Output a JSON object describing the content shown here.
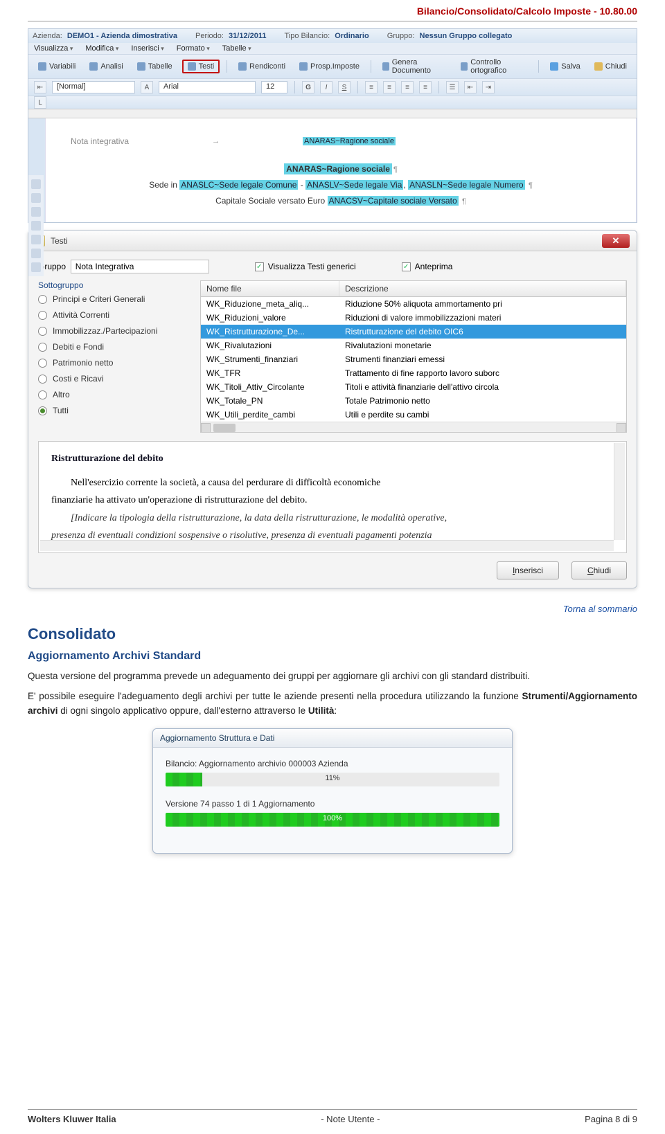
{
  "header": {
    "breadcrumb": "Bilancio/Consolidato/Calcolo Imposte  -  10.80.00"
  },
  "app": {
    "labels": {
      "azienda": "Azienda:",
      "periodo": "Periodo:",
      "tipo": "Tipo Bilancio:",
      "gruppo": "Gruppo:"
    },
    "values": {
      "azienda": "DEMO1 - Azienda dimostrativa",
      "periodo": "31/12/2011",
      "tipo": "Ordinario",
      "gruppo": "Nessun Gruppo collegato"
    },
    "menu": [
      "Visualizza",
      "Modifica",
      "Inserisci",
      "Formato",
      "Tabelle"
    ],
    "toolbar": {
      "variabili": "Variabili",
      "analisi": "Analisi",
      "tabelle": "Tabelle",
      "testi": "Testi",
      "rendiconti": "Rendiconti",
      "prosp": "Prosp.Imposte",
      "genera": "Genera Documento",
      "spell": "Controllo ortografico",
      "salva": "Salva",
      "chiudi": "Chiudi"
    },
    "format": {
      "style": "[Normal]",
      "font": "Arial",
      "size": "12"
    },
    "doc": {
      "nota": "Nota integrativa",
      "ragione": "ANARAS~Ragione sociale",
      "title": "ANARAS~Ragione sociale",
      "sede_pre": "Sede in ",
      "sede_comune": "ANASLC~Sede legale Comune",
      "sede_mid": " - ",
      "sede_via": "ANASLV~Sede legale Via",
      "sede_coma": ", ",
      "sede_num": "ANASLN~Sede legale Numero",
      "cap_pre": "Capitale Sociale versato Euro ",
      "cap_hl": "ANACSV~Capitale sociale Versato"
    }
  },
  "dialog": {
    "title": "Testi",
    "gruppo_label": "Gruppo",
    "gruppo_value": "Nota Integrativa",
    "chk_visualizza": "Visualizza Testi generici",
    "chk_anteprima": "Anteprima",
    "sotto_label": "Sottogruppo",
    "radios": [
      "Principi e Criteri Generali",
      "Attività Correnti",
      "Immobilizzaz./Partecipazioni",
      "Debiti e Fondi",
      "Patrimonio netto",
      "Costi e Ricavi",
      "Altro",
      "Tutti"
    ],
    "radio_selected_index": 7,
    "table": {
      "col1": "Nome file",
      "col2": "Descrizione",
      "rows": [
        {
          "f": "WK_Riduzione_meta_aliq...",
          "d": "Riduzione 50% aliquota ammortamento pri"
        },
        {
          "f": "WK_Riduzioni_valore",
          "d": "Riduzioni di valore immobilizzazioni materi"
        },
        {
          "f": "WK_Ristrutturazione_De...",
          "d": "Ristrutturazione del debito OIC6",
          "sel": true
        },
        {
          "f": "WK_Rivalutazioni",
          "d": "Rivalutazioni monetarie"
        },
        {
          "f": "WK_Strumenti_finanziari",
          "d": "Strumenti finanziari emessi"
        },
        {
          "f": "WK_TFR",
          "d": "Trattamento di fine rapporto lavoro suborc"
        },
        {
          "f": "WK_Titoli_Attiv_Circolante",
          "d": "Titoli e attività finanziarie dell'attivo circola"
        },
        {
          "f": "WK_Totale_PN",
          "d": "Totale Patrimonio netto"
        },
        {
          "f": "WK_Utili_perdite_cambi",
          "d": "Utili e perdite su cambi"
        }
      ]
    },
    "preview": {
      "title": "Ristrutturazione del debito",
      "p1a": "Nell'esercizio corrente la società, a causa del perdurare di difficoltà economiche",
      "p1b": "finanziarie ha attivato un'operazione di ristrutturazione del debito.",
      "p2": "[Indicare la tipologia della ristrutturazione, la data della ristrutturazione, le modalità operative,",
      "p3": "presenza di eventuali condizioni sospensive o risolutive, presenza di eventuali pagamenti potenzia"
    },
    "btn_inserisci": "Inserisci",
    "btn_chiudi": "Chiudi"
  },
  "content": {
    "back_link": "Torna al sommario",
    "title": "Consolidato",
    "subtitle": "Aggiornamento Archivi Standard",
    "p1": "Questa versione del programma prevede un adeguamento dei gruppi per aggiornare gli archivi con gli standard distribuiti.",
    "p2_a": "E' possibile eseguire l'adeguamento degli archivi per tutte le aziende presenti nella procedura utilizzando la funzione ",
    "p2_b": "Strumenti/Aggiornamento archivi",
    "p2_c": " di ogni singolo applicativo oppure, dall'esterno attraverso le ",
    "p2_d": "Utilità",
    "p2_e": ":"
  },
  "progress": {
    "title": "Aggiornamento Struttura e Dati",
    "label1": "Bilancio: Aggiornamento archivio 000003 Azienda",
    "pct1": "11%",
    "fill1_width": "11%",
    "label2": "Versione 74 passo 1 di 1 Aggiornamento",
    "pct2": "100%",
    "fill2_width": "100%"
  },
  "footer": {
    "left": "Wolters Kluwer Italia",
    "center": "- Note Utente -",
    "right": "Pagina  8 di 9"
  }
}
